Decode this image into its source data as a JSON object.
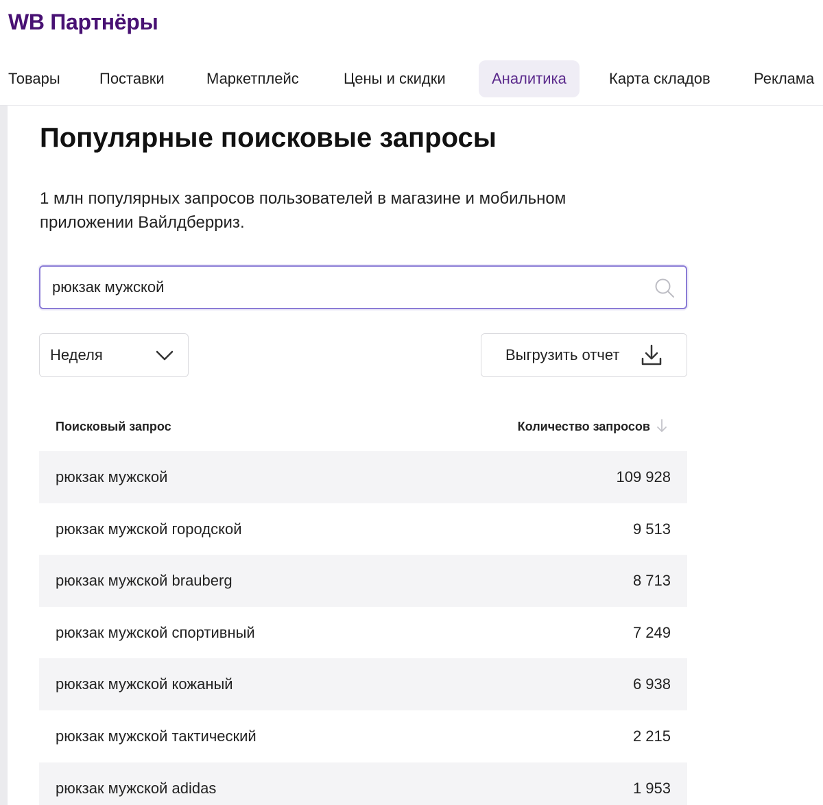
{
  "header": {
    "logo": "WB Партнёры",
    "nav": [
      {
        "label": "Товары",
        "active": false
      },
      {
        "label": "Поставки",
        "active": false
      },
      {
        "label": "Маркетплейс",
        "active": false
      },
      {
        "label": "Цены и скидки",
        "active": false
      },
      {
        "label": "Аналитика",
        "active": true
      },
      {
        "label": "Карта складов",
        "active": false
      },
      {
        "label": "Реклама",
        "active": false
      }
    ]
  },
  "main": {
    "title": "Популярные поисковые запросы",
    "subtitle": "1 млн популярных запросов пользователей в магазине и мобильном приложении Вайлдберриз.",
    "search": {
      "value": "рюкзак мужской",
      "icon": "search-icon"
    },
    "period": {
      "selected": "Неделя",
      "icon": "chevron-down-icon"
    },
    "export": {
      "label": "Выгрузить отчет",
      "icon": "download-icon"
    },
    "table": {
      "columns": {
        "query": "Поисковый запрос",
        "count": "Количество запросов"
      },
      "sort": {
        "column": "count",
        "direction": "desc",
        "icon": "arrow-down-icon"
      },
      "rows": [
        {
          "query": "рюкзак мужской",
          "count": "109 928"
        },
        {
          "query": "рюкзак мужской городской",
          "count": "9 513"
        },
        {
          "query": "рюкзак мужской brauberg",
          "count": "8 713"
        },
        {
          "query": "рюкзак мужской спортивный",
          "count": "7 249"
        },
        {
          "query": "рюкзак мужской кожаный",
          "count": "6 938"
        },
        {
          "query": "рюкзак мужской тактический",
          "count": "2 215"
        },
        {
          "query": "рюкзак мужской adidas",
          "count": "1 953"
        }
      ]
    }
  },
  "colors": {
    "brand": "#481173",
    "accent": "#8b7cd6",
    "active_tab_bg": "#efedf5",
    "row_stripe": "#f4f4f6"
  }
}
